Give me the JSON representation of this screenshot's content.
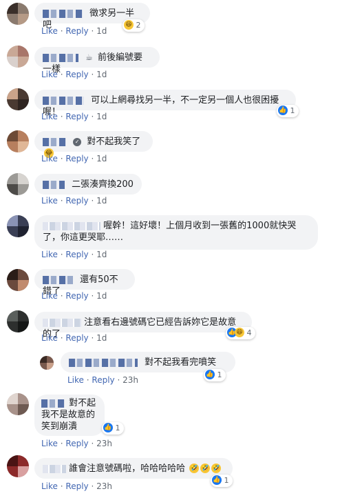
{
  "actions": {
    "like": "Like",
    "reply": "Reply",
    "sep": "·"
  },
  "icons": {
    "like": "thumbs-up-icon",
    "haha": "laughing-face-icon",
    "verified": "shield-check-icon",
    "coffee": "coffee-cup-icon"
  },
  "colors": {
    "link": "#4267b2",
    "bubble": "#f2f3f5",
    "text": "#1c1e21",
    "meta": "#606770",
    "like_blue": "#1877f2"
  },
  "comments": [
    {
      "text": "徵求另一半吧",
      "time": "1d",
      "reactions": "2"
    },
    {
      "text": "前後編號要一樣",
      "time": "1d"
    },
    {
      "text": "可以上網尋找另一半，不一定另一個人也很困擾喔！",
      "time": "1d",
      "reactions": "1"
    },
    {
      "text": "對不起我笑了",
      "time": "1d"
    },
    {
      "text": "二張湊齊換200",
      "time": "1d"
    },
    {
      "text_line1": "喔幹！這好壞！上個月收到一張舊的1000就快哭",
      "text_line2": "了，你這更哭耶……",
      "time": "1d"
    },
    {
      "text": "還有50不錯了",
      "time": "1d"
    },
    {
      "text": "注意看右邊號碼它已經告訴妳它是故意的了",
      "time": "1d",
      "reactions": "4"
    },
    {
      "text": "對不起我看完噴笑",
      "time": "23h",
      "reactions": "1"
    },
    {
      "text_line1": "對不起",
      "text_line2": "我不是故意的",
      "text_line3": "笑到崩潰",
      "time": "23h",
      "reactions": "1"
    },
    {
      "text": "誰會注意號碼啦，哈哈哈哈哈",
      "time": "23h",
      "reactions": "1"
    }
  ]
}
